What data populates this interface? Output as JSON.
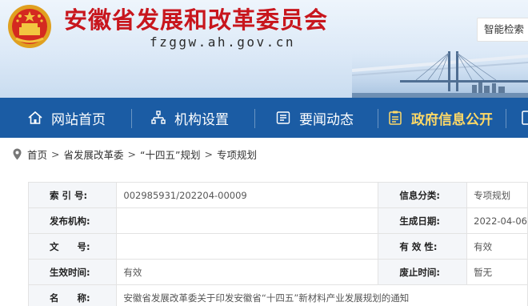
{
  "header": {
    "title": "安徽省发展和改革委员会",
    "domain": "fzggw.ah.gov.cn",
    "search_label": "智能检索"
  },
  "nav": {
    "items": [
      {
        "label": "网站首页",
        "icon": "home-icon"
      },
      {
        "label": "机构设置",
        "icon": "org-chart-icon"
      },
      {
        "label": "要闻动态",
        "icon": "news-icon"
      },
      {
        "label": "政府信息公开",
        "icon": "info-disclosure-icon",
        "active": true
      }
    ]
  },
  "breadcrumb": {
    "items": [
      "首页",
      "省发展改革委",
      "“十四五”规划",
      "专项规划"
    ],
    "separator": ">"
  },
  "info_table": {
    "rows": [
      {
        "k1": "索 引 号:",
        "v1": "002985931/202204-00009",
        "k2": "信息分类:",
        "v2": "专项规划"
      },
      {
        "k1": "发布机构:",
        "v1": "",
        "k2": "生成日期:",
        "v2": "2022-04-06"
      },
      {
        "k1": "文　　号:",
        "v1": "",
        "k2": "有 效 性:",
        "v2": "有效"
      },
      {
        "k1": "生效时间:",
        "v1": "有效",
        "k2": "废止时间:",
        "v2": "暂无"
      }
    ],
    "name_row": {
      "k": "名　　称:",
      "v": "安徽省发展改革委关于印发安徽省“十四五”新材料产业发展规划的通知"
    }
  },
  "colors": {
    "title_red": "#c8161d",
    "nav_blue": "#1b5ca4",
    "active_gold": "#ffd966"
  }
}
